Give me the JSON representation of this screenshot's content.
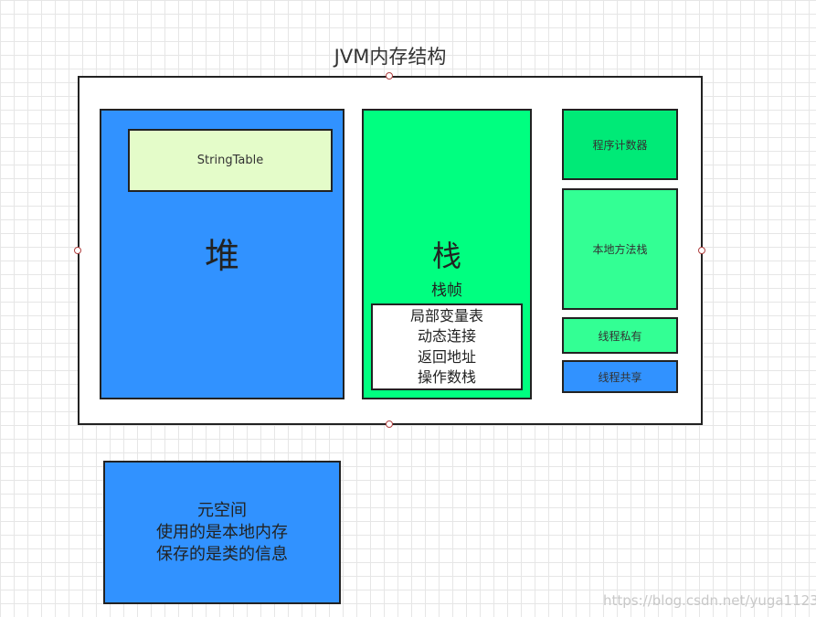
{
  "diagram": {
    "title": "JVM内存结构",
    "heap": {
      "label": "堆",
      "string_table": "StringTable",
      "color": "#3192ff"
    },
    "stack": {
      "label": "栈",
      "frame_label": "栈帧",
      "frame_items": [
        "局部变量表",
        "动态连接",
        "返回地址",
        "操作数栈"
      ],
      "color": "#00ff80"
    },
    "program_counter": "程序计数器",
    "native_method_stack": "本地方法栈",
    "legend": {
      "thread_private": "线程私有",
      "thread_shared": "线程共享",
      "private_color": "#33ff94",
      "shared_color": "#3192ff"
    },
    "metaspace": {
      "lines": [
        "元空间",
        "使用的是本地内存",
        "保存的是类的信息"
      ]
    },
    "watermark": "https://blog.csdn.net/yuga1123"
  }
}
